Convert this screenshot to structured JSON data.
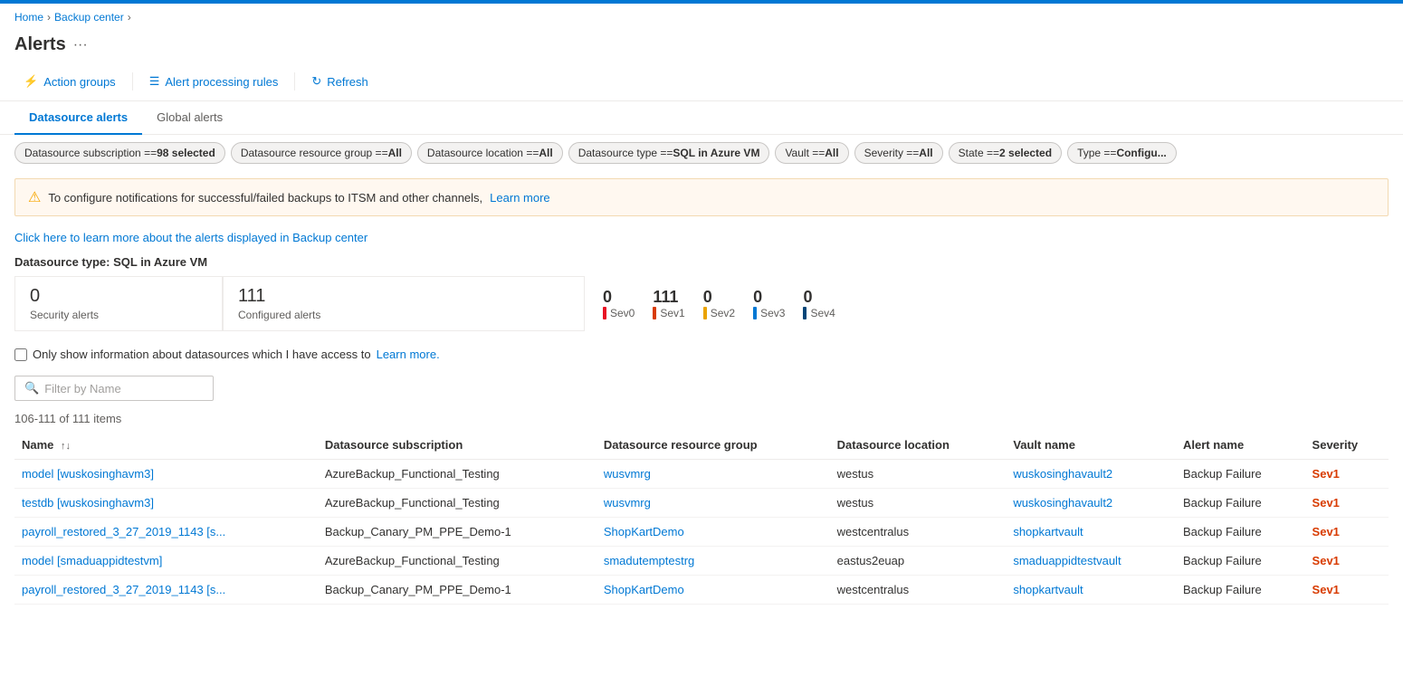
{
  "topBorder": true,
  "breadcrumb": {
    "items": [
      {
        "label": "Home",
        "href": "#"
      },
      {
        "label": "Backup center",
        "href": "#"
      }
    ]
  },
  "page": {
    "title": "Alerts",
    "menuIcon": "···"
  },
  "toolbar": {
    "buttons": [
      {
        "id": "action-groups",
        "icon": "⚡",
        "label": "Action groups"
      },
      {
        "id": "alert-processing-rules",
        "icon": "☰",
        "label": "Alert processing rules"
      },
      {
        "id": "refresh",
        "icon": "↻",
        "label": "Refresh"
      }
    ]
  },
  "tabs": [
    {
      "id": "datasource-alerts",
      "label": "Datasource alerts",
      "active": true
    },
    {
      "id": "global-alerts",
      "label": "Global alerts",
      "active": false
    }
  ],
  "filters": [
    {
      "id": "subscription",
      "text": "Datasource subscription == ",
      "bold": "98 selected"
    },
    {
      "id": "resource-group",
      "text": "Datasource resource group == ",
      "bold": "All"
    },
    {
      "id": "location",
      "text": "Datasource location == ",
      "bold": "All"
    },
    {
      "id": "type",
      "text": "Datasource type == ",
      "bold": "SQL in Azure VM"
    },
    {
      "id": "vault",
      "text": "Vault == ",
      "bold": "All"
    },
    {
      "id": "severity",
      "text": "Severity == ",
      "bold": "All"
    },
    {
      "id": "state",
      "text": "State == ",
      "bold": "2 selected"
    },
    {
      "id": "alert-type",
      "text": "Type == ",
      "bold": "Configu..."
    }
  ],
  "warningBanner": {
    "text": "To configure notifications for successful/failed backups to ITSM and other channels,",
    "linkText": "Learn more",
    "linkHref": "#"
  },
  "infoLink": {
    "text": "Click here to learn more about the alerts displayed in Backup center",
    "href": "#"
  },
  "datasourceLabel": "Datasource type: SQL in Azure VM",
  "stats": {
    "security": {
      "number": "0",
      "label": "Security alerts"
    },
    "configured": {
      "number": "111",
      "label": "Configured alerts"
    },
    "severities": [
      {
        "id": "sev0",
        "label": "Sev0",
        "count": "0",
        "colorClass": "sev0-color"
      },
      {
        "id": "sev1",
        "label": "Sev1",
        "count": "111",
        "colorClass": "sev1-color"
      },
      {
        "id": "sev2",
        "label": "Sev2",
        "count": "0",
        "colorClass": "sev2-color"
      },
      {
        "id": "sev3",
        "label": "Sev3",
        "count": "0",
        "colorClass": "sev3-color"
      },
      {
        "id": "sev4",
        "label": "Sev4",
        "count": "0",
        "colorClass": "sev4-color"
      }
    ]
  },
  "checkboxRow": {
    "label": "Only show information about datasources which I have access to",
    "linkText": "Learn more.",
    "linkHref": "#"
  },
  "filterInput": {
    "placeholder": "Filter by Name"
  },
  "itemsCount": "106-111 of 111 items",
  "tableColumns": [
    {
      "id": "name",
      "label": "Name",
      "sortable": true
    },
    {
      "id": "subscription",
      "label": "Datasource subscription",
      "sortable": false
    },
    {
      "id": "resource-group",
      "label": "Datasource resource group",
      "sortable": false
    },
    {
      "id": "location",
      "label": "Datasource location",
      "sortable": false
    },
    {
      "id": "vault-name",
      "label": "Vault name",
      "sortable": false
    },
    {
      "id": "alert-name",
      "label": "Alert name",
      "sortable": false
    },
    {
      "id": "severity",
      "label": "Severity",
      "sortable": false
    }
  ],
  "tableRows": [
    {
      "name": "model [wuskosinghavm3]",
      "subscription": "AzureBackup_Functional_Testing",
      "resourceGroup": "wusvmrg",
      "location": "westus",
      "vaultName": "wuskosinghavault2",
      "alertName": "Backup Failure",
      "severity": "Sev1"
    },
    {
      "name": "testdb [wuskosinghavm3]",
      "subscription": "AzureBackup_Functional_Testing",
      "resourceGroup": "wusvmrg",
      "location": "westus",
      "vaultName": "wuskosinghavault2",
      "alertName": "Backup Failure",
      "severity": "Sev1"
    },
    {
      "name": "payroll_restored_3_27_2019_1143 [s...",
      "subscription": "Backup_Canary_PM_PPE_Demo-1",
      "resourceGroup": "ShopKartDemo",
      "location": "westcentralus",
      "vaultName": "shopkartvault",
      "alertName": "Backup Failure",
      "severity": "Sev1"
    },
    {
      "name": "model [smaduappidtestvm]",
      "subscription": "AzureBackup_Functional_Testing",
      "resourceGroup": "smadutemptestrg",
      "location": "eastus2euap",
      "vaultName": "smaduappidtestvault",
      "alertName": "Backup Failure",
      "severity": "Sev1"
    },
    {
      "name": "payroll_restored_3_27_2019_1143 [s...",
      "subscription": "Backup_Canary_PM_PPE_Demo-1",
      "resourceGroup": "ShopKartDemo",
      "location": "westcentralus",
      "vaultName": "shopkartvault",
      "alertName": "Backup Failure",
      "severity": "Sev1"
    }
  ]
}
